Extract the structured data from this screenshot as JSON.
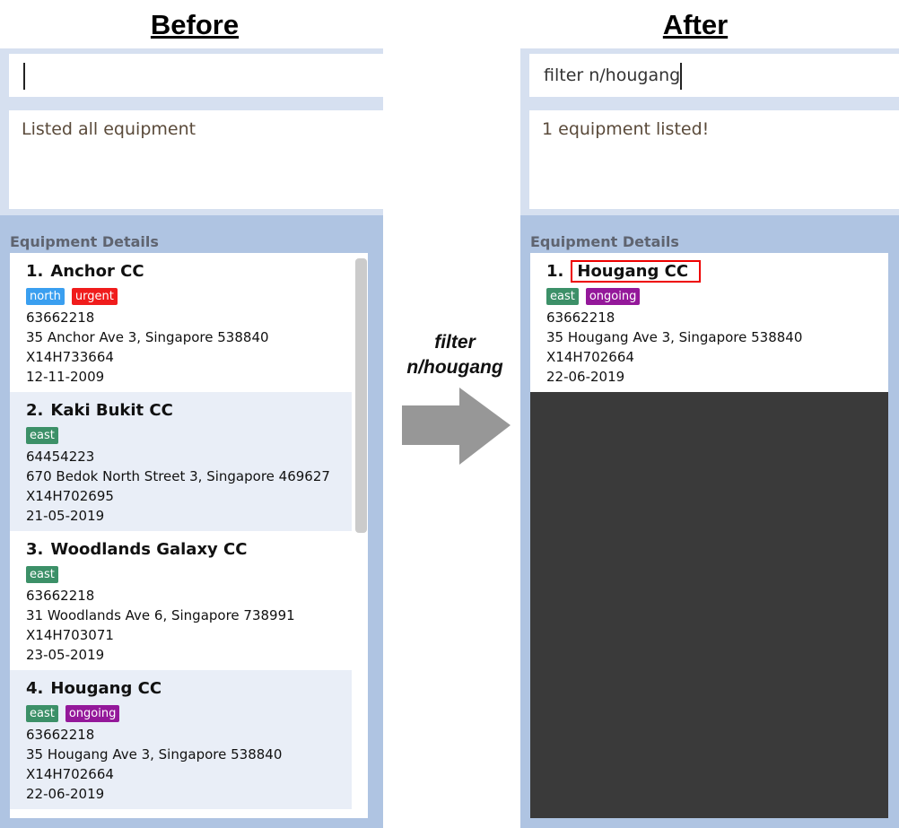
{
  "before": {
    "heading": "Before",
    "command_value": "",
    "result": "Listed all equipment",
    "list_label": "Equipment Details",
    "items": [
      {
        "index": "1.",
        "name": "Anchor CC",
        "tags": [
          {
            "text": "north",
            "color": "#3a9ff0"
          },
          {
            "text": "urgent",
            "color": "#f01c1c"
          }
        ],
        "phone": "63662218",
        "address": "35 Anchor Ave 3, Singapore 538840",
        "serial": "X14H733664",
        "date": "12-11-2009"
      },
      {
        "index": "2.",
        "name": "Kaki Bukit CC",
        "tags": [
          {
            "text": "east",
            "color": "#3c9068"
          }
        ],
        "phone": "64454223",
        "address": "670 Bedok North Street 3, Singapore 469627",
        "serial": "X14H702695",
        "date": "21-05-2019"
      },
      {
        "index": "3.",
        "name": "Woodlands Galaxy CC",
        "tags": [
          {
            "text": "east",
            "color": "#3c9068"
          }
        ],
        "phone": "63662218",
        "address": "31 Woodlands Ave 6, Singapore 738991",
        "serial": "X14H703071",
        "date": "23-05-2019"
      },
      {
        "index": "4.",
        "name": "Hougang CC",
        "tags": [
          {
            "text": "east",
            "color": "#3c9068"
          },
          {
            "text": "ongoing",
            "color": "#94189a"
          }
        ],
        "phone": "63662218",
        "address": "35 Hougang Ave 3, Singapore 538840",
        "serial": "X14H702664",
        "date": "22-06-2019"
      }
    ]
  },
  "arrow": {
    "line1": "filter",
    "line2": "n/hougang"
  },
  "after": {
    "heading": "After",
    "command_value": "filter n/hougang",
    "result": "1 equipment listed!",
    "list_label": "Equipment Details",
    "items": [
      {
        "index": "1.",
        "name": "Hougang CC",
        "tags": [
          {
            "text": "east",
            "color": "#3c9068"
          },
          {
            "text": "ongoing",
            "color": "#94189a"
          }
        ],
        "phone": "63662218",
        "address": "35 Hougang Ave 3, Singapore 538840",
        "serial": "X14H702664",
        "date": "22-06-2019"
      }
    ]
  }
}
